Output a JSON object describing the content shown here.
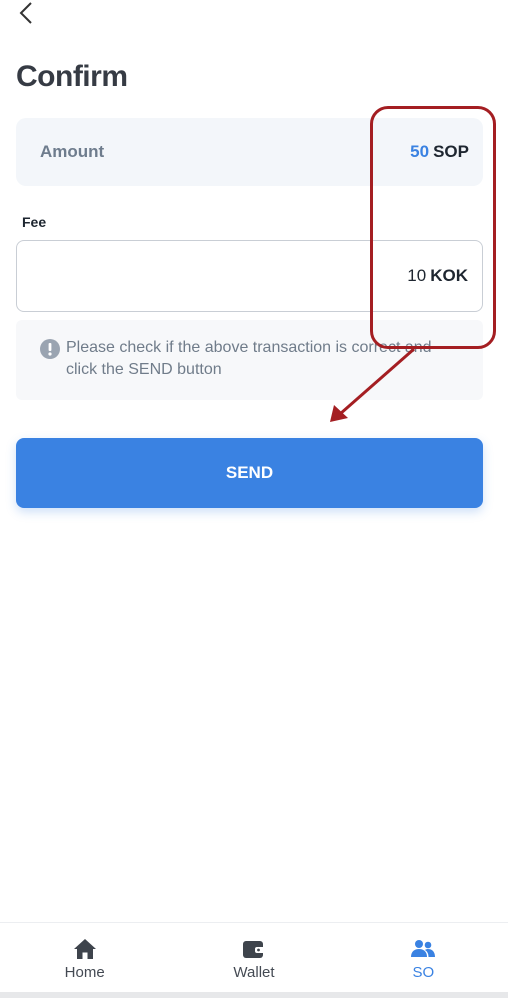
{
  "header": {
    "title": "Confirm",
    "back_icon": "chevron-left-icon"
  },
  "amount": {
    "label": "Amount",
    "value": "50",
    "unit": "SOP"
  },
  "fee": {
    "label": "Fee",
    "value": "10",
    "unit": "KOK"
  },
  "notice": {
    "icon": "info-circle-icon",
    "text": "Please check if the above transaction is correct and click the SEND button"
  },
  "send_button": {
    "label": "SEND"
  },
  "bottom_nav": {
    "items": [
      {
        "label": "Home",
        "icon": "home-icon",
        "active": false
      },
      {
        "label": "Wallet",
        "icon": "wallet-icon",
        "active": false
      },
      {
        "label": "SO",
        "icon": "users-icon",
        "active": true
      }
    ]
  },
  "colors": {
    "accent": "#3a82e2",
    "annotation": "#a41e22",
    "card_bg": "#f3f6fa",
    "muted_text": "#707c8a"
  }
}
